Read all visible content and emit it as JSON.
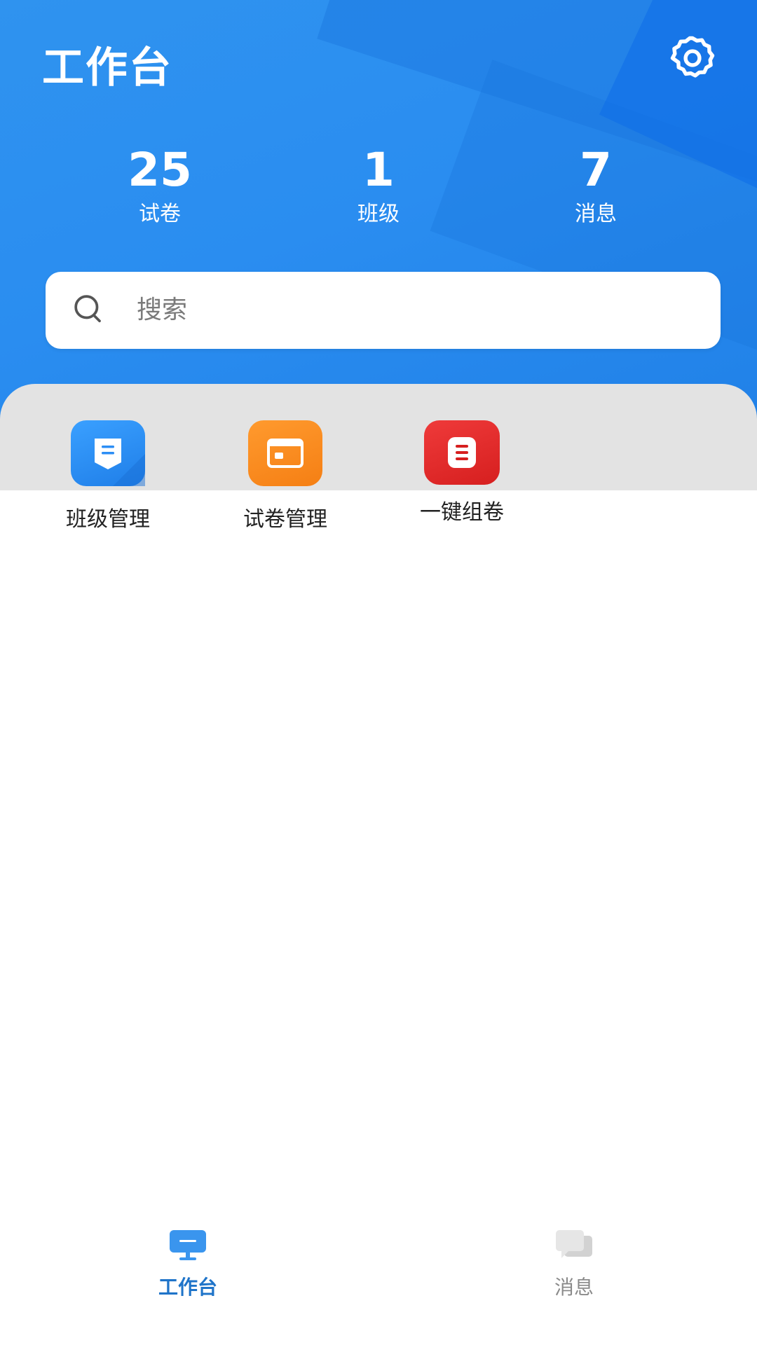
{
  "header": {
    "title": "工作台",
    "settings_icon": "gear-icon"
  },
  "stats": [
    {
      "value": "25",
      "label": "试卷"
    },
    {
      "value": "1",
      "label": "班级"
    },
    {
      "value": "7",
      "label": "消息"
    }
  ],
  "search": {
    "placeholder": "搜索"
  },
  "apps": [
    {
      "label": "班级管理",
      "icon": "class-management-icon",
      "color": "#2c8ef5"
    },
    {
      "label": "试卷管理",
      "icon": "exam-paper-icon",
      "color": "#f98a1e"
    },
    {
      "label": "一键组卷",
      "icon": "quick-compose-icon",
      "color": "#e02a2a"
    }
  ],
  "tabbar": {
    "tabs": [
      {
        "label": "工作台",
        "icon": "monitor-icon",
        "active": true
      },
      {
        "label": "消息",
        "icon": "chat-icon",
        "active": false
      }
    ],
    "active_color": "#1f74c9",
    "inactive_color": "#8a8a8a"
  }
}
